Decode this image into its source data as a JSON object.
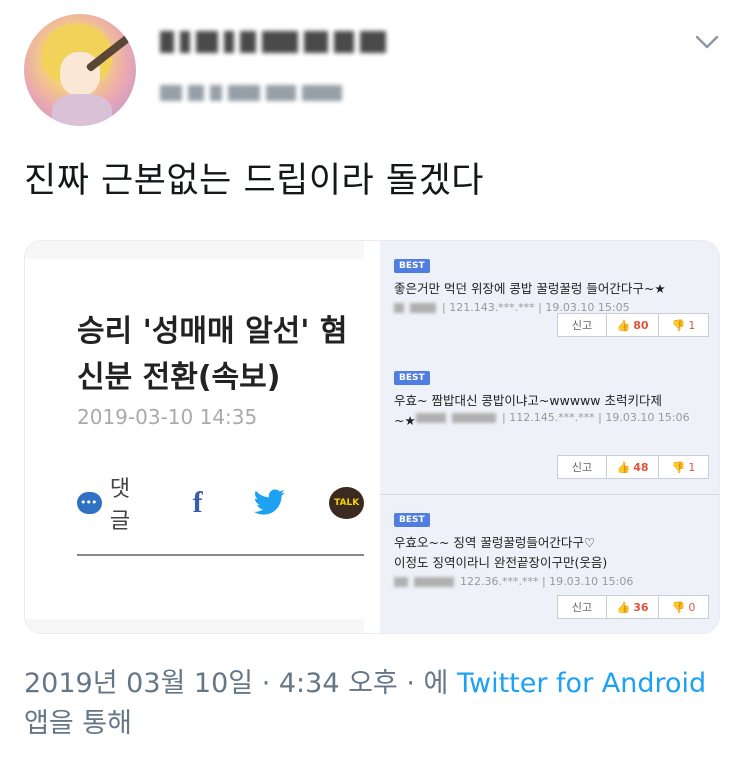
{
  "tweet": {
    "text": "진짜 근본없는 드립이라 돌겠다"
  },
  "article": {
    "headline": "승리 '성매매 알선' 혐\n신분 전환(속보)",
    "date": "2019-03-10 14:35",
    "comment_label": "댓글",
    "facebook_glyph": "f",
    "kakaotalk_label": "TALK"
  },
  "comments": [
    {
      "badge": "BEST",
      "text": "좋은거만 먹던 위장에 콩밥 꿀렁꿀렁 들어간다구~★",
      "meta": "| 121.143.***.*** | 19.03.10 15:05",
      "report": "신고",
      "up_icon": "👍",
      "up": "80",
      "down_icon": "👎",
      "down": "1"
    },
    {
      "badge": "BEST",
      "text": "우효~ 짬밥대신 콩밥이냐고~wwwww 초럭키다제\n~★",
      "meta": "| 112.145.***.*** | 19.03.10 15:06",
      "report": "신고",
      "up_icon": "👍",
      "up": "48",
      "down_icon": "👎",
      "down": "1"
    },
    {
      "badge": "BEST",
      "text": "우효오~~ 징역 꿀렁꿀렁들어간다구♡\n이정도 징역이라니 완전끝장이구만(웃음)",
      "meta": "122.36.***.*** | 19.03.10 15:06",
      "report": "신고",
      "up_icon": "👍",
      "up": "36",
      "down_icon": "👎",
      "down": "0"
    }
  ],
  "footer": {
    "date": "2019년 03월 10일",
    "sep1": " · ",
    "time": "4:34 오후",
    "sep2": " · ",
    "via_prefix": "에 ",
    "client": "Twitter for Android",
    "via_suffix": " 앱을 통해"
  },
  "colors": {
    "link": "#1da1f2",
    "meta": "#657786",
    "best_badge": "#4f7de0",
    "upvote": "#e0533b"
  }
}
